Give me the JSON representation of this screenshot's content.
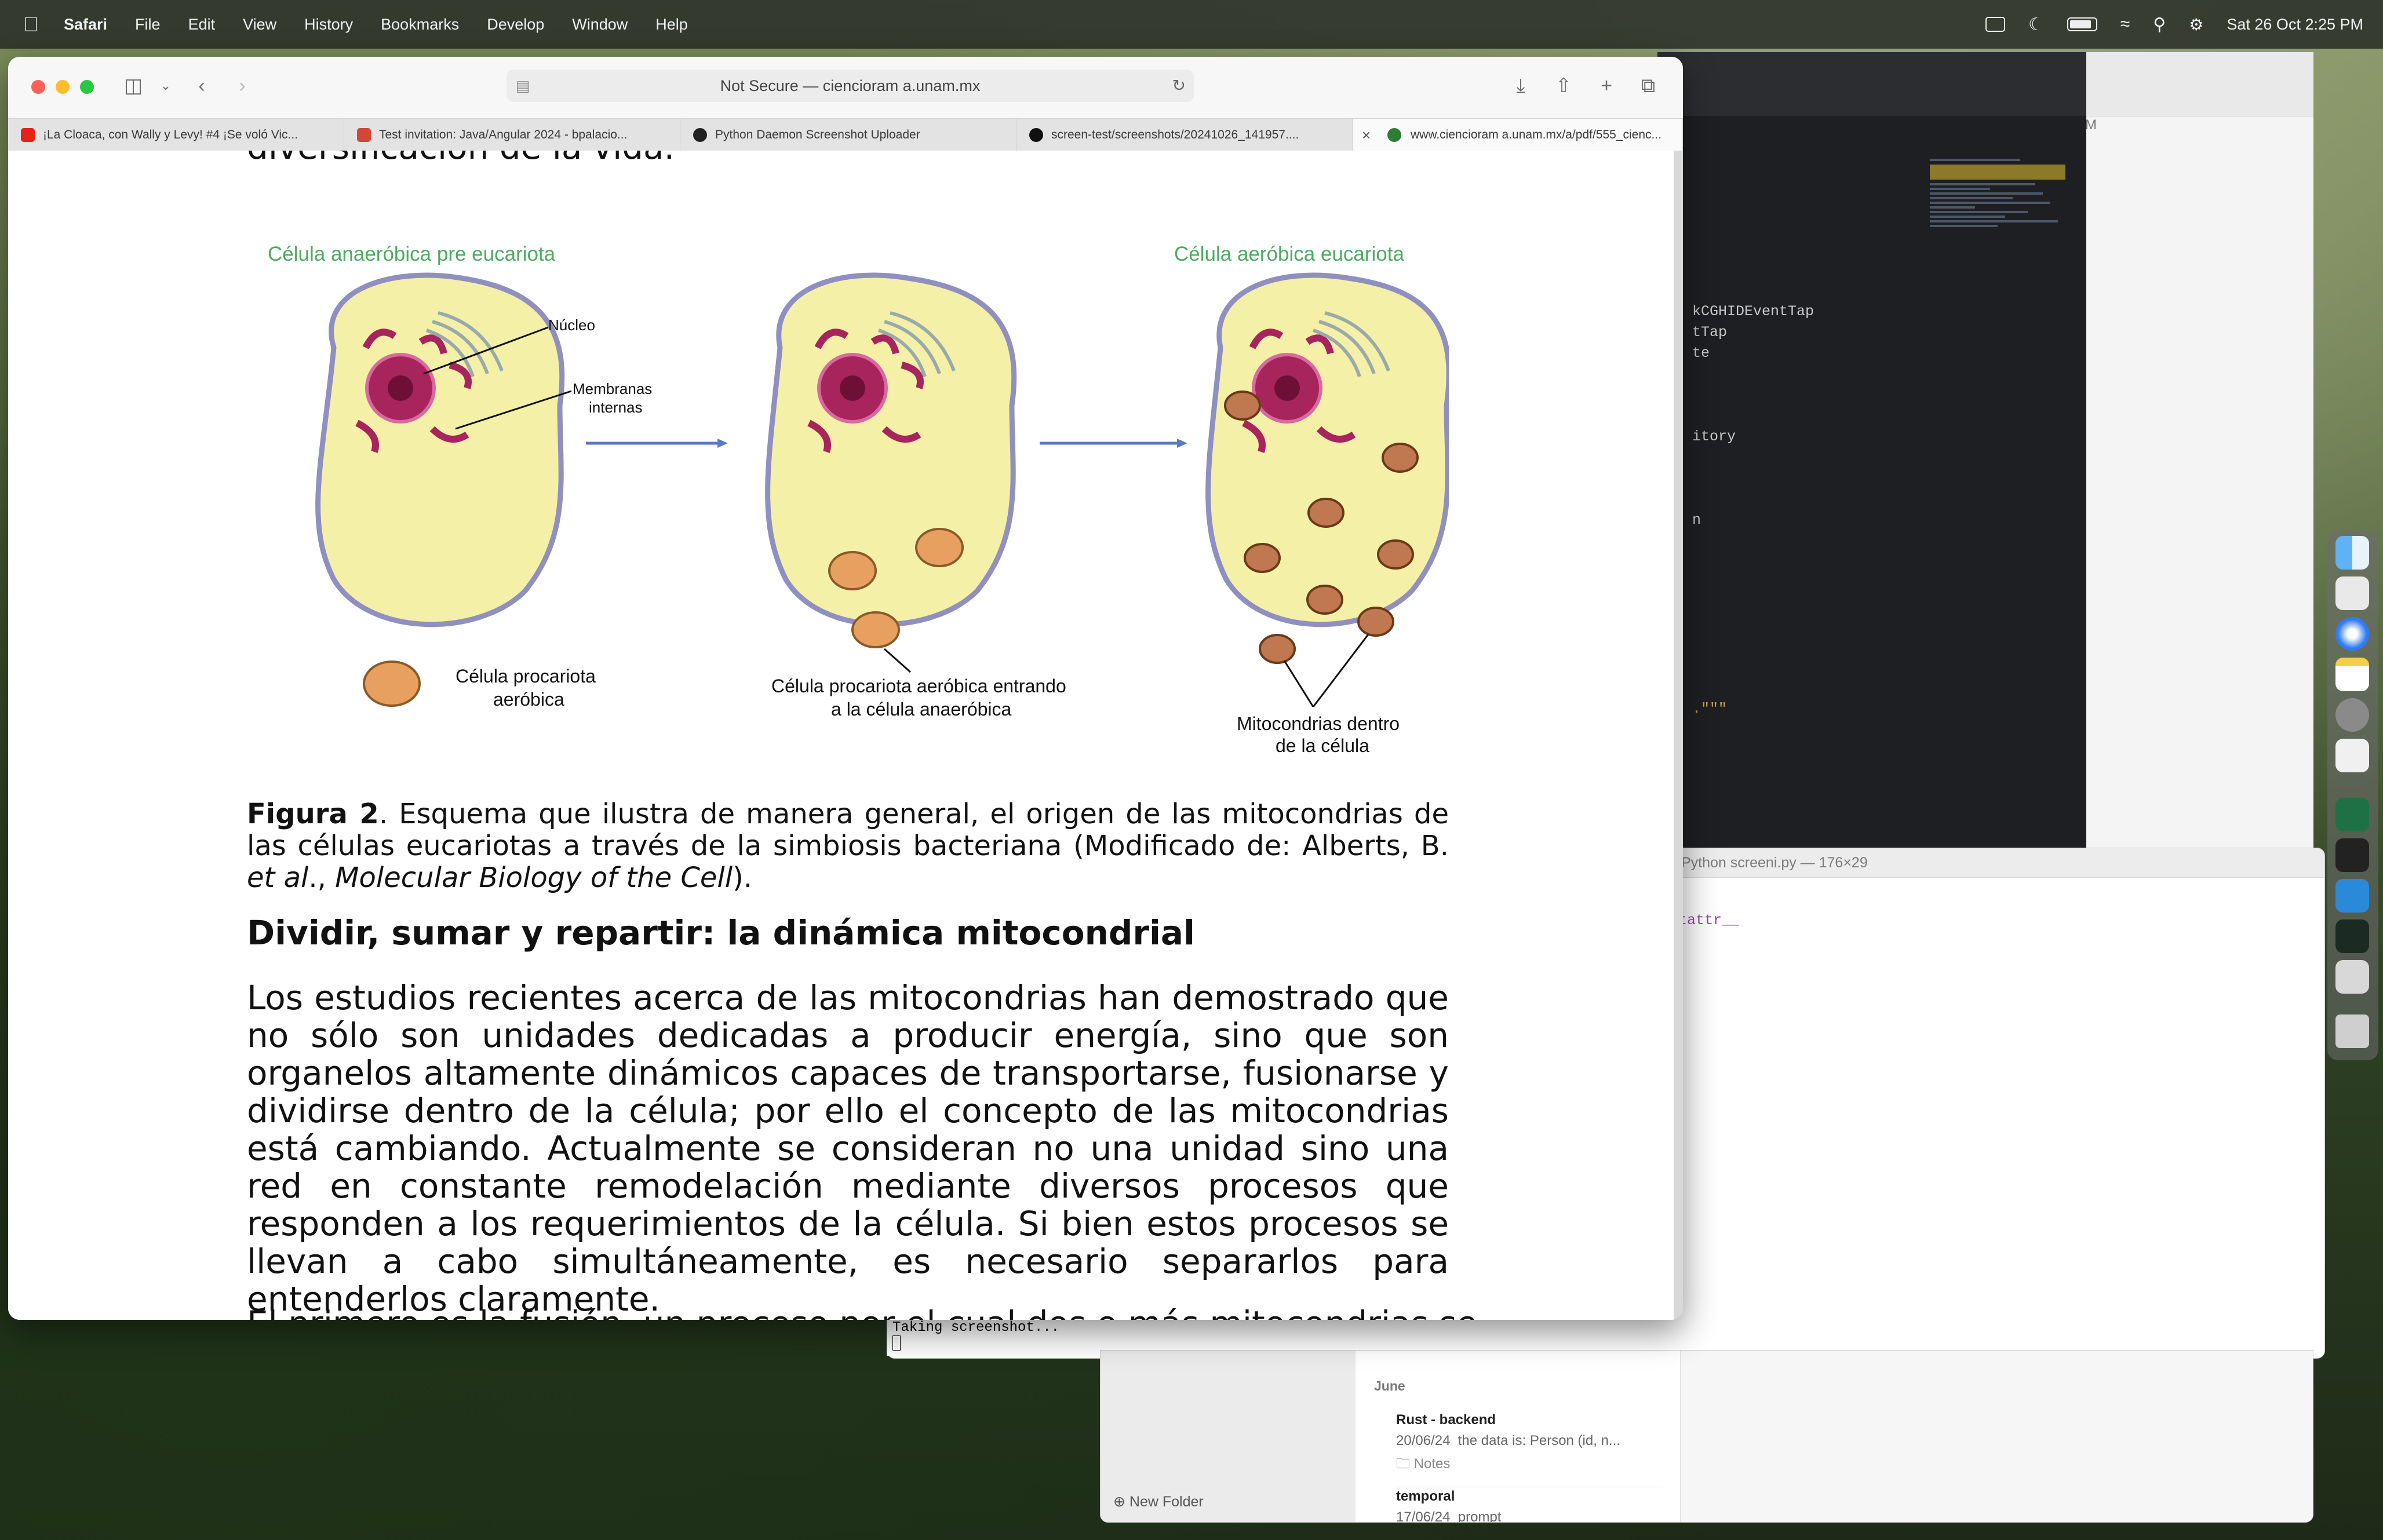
{
  "menubar": {
    "app": "Safari",
    "items": [
      "File",
      "Edit",
      "View",
      "History",
      "Bookmarks",
      "Develop",
      "Window",
      "Help"
    ],
    "clock": "Sat 26 Oct  2:25 PM"
  },
  "safari": {
    "address": "Not Secure — ciencioram a.unam.mx",
    "tabs": [
      {
        "label": "¡La Cloaca, con Wally y Levy! #4 ¡Se voló Vic...",
        "icon": "youtube-icon",
        "color": "#e62117"
      },
      {
        "label": "Test invitation: Java/Angular 2024 - bpalacio...",
        "icon": "gmail-icon",
        "color": "#d44638"
      },
      {
        "label": "Python Daemon Screenshot Uploader",
        "icon": "chatgpt-icon",
        "color": "#222222"
      },
      {
        "label": "screen-test/screenshots/20241026_141957....",
        "icon": "github-icon",
        "color": "#111111"
      },
      {
        "label": "www.ciencioram a.unam.mx/a/pdf/555_cienc...",
        "icon": "globe-icon",
        "color": "#2e7d32"
      }
    ]
  },
  "document": {
    "cut_top": "diversificación de la vida.",
    "figure": {
      "label_left": "Célula anaeróbica pre eucariota",
      "label_right": "Célula aeróbica eucariota",
      "nucleus": "Núcleo",
      "membranes_1": "Membranas",
      "membranes_2": "internas",
      "prok_1": "Célula procariota",
      "prok_2": "aeróbica",
      "entering_1": "Célula procariota  aeróbica entrando",
      "entering_2": "a la célula anaeróbica",
      "mito_1": "Mitocondrias dentro",
      "mito_2": "de la célula"
    },
    "caption_bold": "Figura 2",
    "caption_1": ". Esquema que ilustra de manera general, el origen de las mitocondrias de las células eucariotas a través de la simbiosis bacteriana (Modificado de: Alberts, B. ",
    "caption_it1": "et al",
    "caption_2": "., ",
    "caption_it2": "Molecular Biology of the Cell",
    "caption_3": ").",
    "heading": "Dividir, sumar y repartir: la dinámica mitocondrial",
    "paragraph": "Los estudios recientes acerca de las mitocondrias han demostrado que no sólo son unidades dedicadas a producir energía, sino que son organelos altamente dinámicos capaces de transportarse, fusionarse y dividirse dentro de la célula; por ello el concepto de las mitocondrias está cambiando. Actualmente se consideran no una unidad sino una red en constante remodelación mediante diversos procesos que responden a los requerimientos de la célula. Si bien estos procesos se llevan a cabo simultáneamente, es necesario separarlos para entenderlos claramente.",
    "cut_bottom": "El primero es la fusión, un proceso por el cual dos o más mitocondrias se"
  },
  "background": {
    "editor_code": [
      "kCGHIDEventTap",
      "tTap",
      "te",
      "itory",
      "n",
      ".\"\"\""
    ],
    "terminal_title": "Python screeni.py — 176×29",
    "terminal_text": "etattr__",
    "terminal_small": "Taking screenshot...",
    "pm_text": "PM"
  },
  "notes": {
    "new_folder": "New Folder",
    "month": "June",
    "items": [
      {
        "title": "Rust - backend",
        "date": "20/06/24",
        "preview": "the data is: Person (id, n...",
        "folder": "Notes"
      },
      {
        "title": "temporal",
        "date": "17/06/24",
        "preview": "prompt"
      }
    ]
  },
  "colors": {
    "figure_green": "#4aab5e",
    "cell_fill": "#f5f0a8",
    "cell_border": "#8f8fc0",
    "nucleus": "#a8245c",
    "mito": "#e8a060",
    "arrow": "#5a7ac0"
  }
}
